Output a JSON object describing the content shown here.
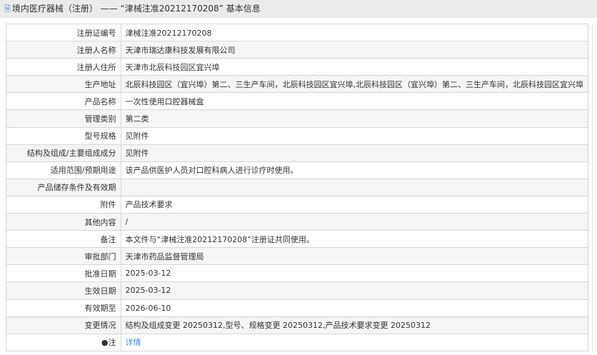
{
  "header": {
    "title": "境内医疗器械（注册） —— “津械注准20212170208” 基本信息",
    "icon": "document-icon"
  },
  "rows": [
    {
      "label": "注册证编号",
      "value": "津械注准20212170208"
    },
    {
      "label": "注册人名称",
      "value": "天津市瑞达康科技发展有限公司"
    },
    {
      "label": "注册人住所",
      "value": "天津市北辰科技园区宜兴埠"
    },
    {
      "label": "生产地址",
      "value": "北辰科技园区（宜兴埠）第二、三生产车间，北辰科技园区宜兴埠,北辰科技园区（宜兴埠）第二、三生产车间，北辰科技园区宜兴埠"
    },
    {
      "label": "产品名称",
      "value": "一次性使用口腔器械盒"
    },
    {
      "label": "管理类别",
      "value": "第二类"
    },
    {
      "label": "型号规格",
      "value": "见附件"
    },
    {
      "label": "结构及组成/主要组成成分",
      "value": "见附件"
    },
    {
      "label": "适用范围/预期用途",
      "value": "该产品供医护人员对口腔科病人进行诊疗时使用。"
    },
    {
      "label": "产品储存条件及有效期",
      "value": ""
    },
    {
      "label": "附件",
      "value": "产品技术要求"
    },
    {
      "label": "其他内容",
      "value": "/"
    },
    {
      "label": "备注",
      "value": "本文件与“津械注准20212170208”注册证共同使用。"
    },
    {
      "label": "审批部门",
      "value": "天津市药品监督管理局"
    },
    {
      "label": "批准日期",
      "value": "2025-03-12"
    },
    {
      "label": "生效日期",
      "value": "2025-03-12"
    },
    {
      "label": "有效期至",
      "value": "2026-06-10"
    },
    {
      "label": "变更情况",
      "value": "结构及组成变更 20250312,型号、规格变更 20250312,产品技术要求变更 20250312"
    }
  ],
  "note": {
    "label": "注",
    "icon": "pin-icon",
    "link": "详情"
  }
}
